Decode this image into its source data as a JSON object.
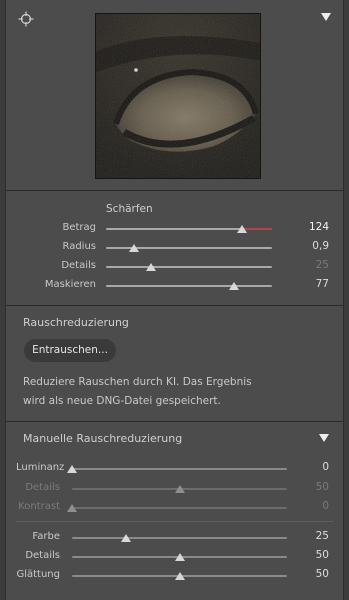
{
  "preview": {
    "image": "eye-closeup"
  },
  "sharpen": {
    "title": "Schärfen",
    "rows": [
      {
        "label": "Betrag",
        "value": "124",
        "fraction": 0.82
      },
      {
        "label": "Radius",
        "value": "0,9",
        "fraction": 0.17
      },
      {
        "label": "Details",
        "value": "25",
        "fraction": 0.27
      },
      {
        "label": "Maskieren",
        "value": "77",
        "fraction": 0.77
      }
    ]
  },
  "noise": {
    "title": "Rauschreduzierung",
    "button_label": "Entrauschen...",
    "info_line1": "Reduziere Rauschen durch KI. Das Ergebnis",
    "info_line2": "wird als neue DNG-Datei gespeichert."
  },
  "manual": {
    "title": "Manuelle Rauschreduzierung",
    "luminance": [
      {
        "label": "Luminanz",
        "value": "0",
        "fraction": 0.0
      },
      {
        "label": "Details",
        "value": "50",
        "fraction": 0.5
      },
      {
        "label": "Kontrast",
        "value": "0",
        "fraction": 0.0
      }
    ],
    "color": [
      {
        "label": "Farbe",
        "value": "25",
        "fraction": 0.25
      },
      {
        "label": "Details",
        "value": "50",
        "fraction": 0.5
      },
      {
        "label": "Glättung",
        "value": "50",
        "fraction": 0.5
      }
    ]
  },
  "colors": {
    "panel_bg": "#4c4c4c",
    "accent_red": "#b0454c"
  }
}
